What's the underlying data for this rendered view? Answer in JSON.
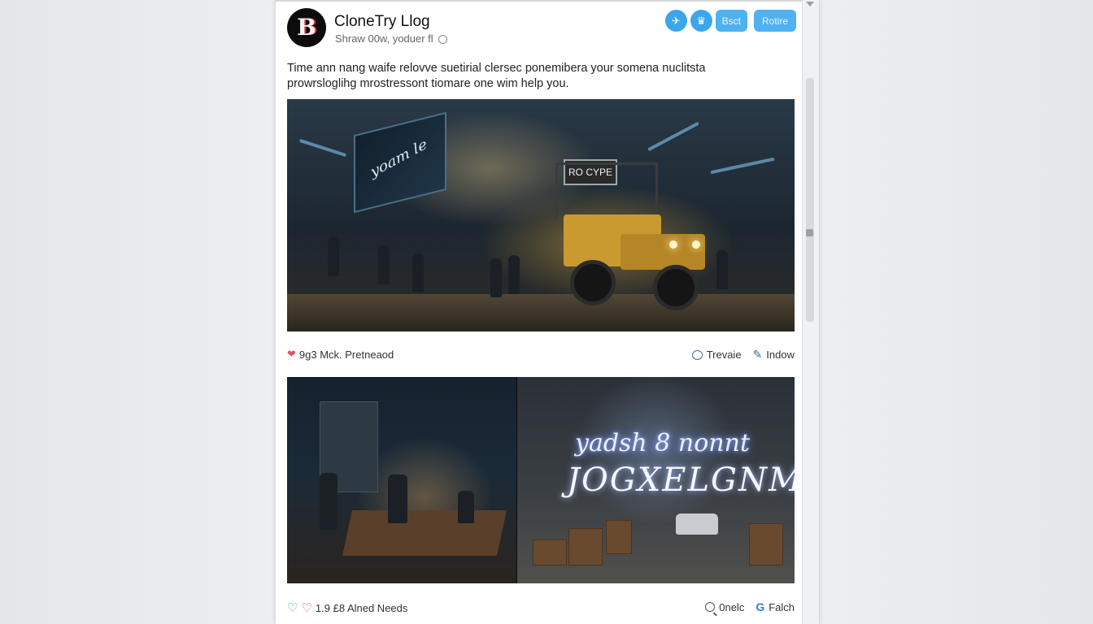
{
  "blog": {
    "title": "CloneTry Llog",
    "subtitle": "Shraw 00w, yoduer fl"
  },
  "header_actions": {
    "twitter_icon": "bird-icon",
    "crown_icon": "crown-icon",
    "button1_label": "Bsct",
    "button2_label": "Rotire"
  },
  "post": {
    "description": "Time ann nang waife relovve suetirial clersec ponemibera your somena nuclitsta prowrsloglihg mrostressont tiomare one wim help you."
  },
  "hero_image": {
    "screen_text": "yoam le",
    "sign_text": "RO CYPE"
  },
  "gallery_right": {
    "neon_line1": "yadsh 8 nonnt",
    "neon_line2": "JOGXELGNMT"
  },
  "post_actions": {
    "likes_text": "9g3 Mck. Pretneaod",
    "comment_label": "Trevaie",
    "share_label": "Indow"
  },
  "gallery_actions": {
    "likes_text": "1.9 £8 Alned Needs",
    "search_label": "0nelc",
    "g_label": "Falch"
  },
  "colors": {
    "accent": "#3aa6ec",
    "like": "#e0546a",
    "link": "#3b6fa0"
  }
}
